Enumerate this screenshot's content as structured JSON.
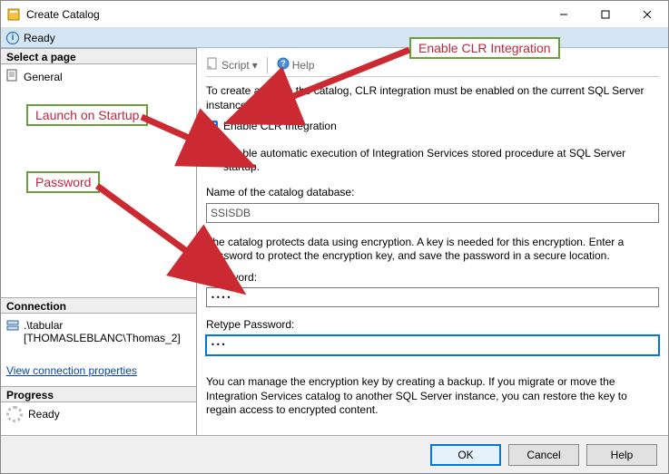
{
  "window": {
    "title": "Create Catalog"
  },
  "status": {
    "text": "Ready"
  },
  "sidebar": {
    "select_page_header": "Select a page",
    "pages": [
      {
        "label": "General"
      }
    ],
    "connection_header": "Connection",
    "conn_server": ".\\tabular",
    "conn_user": "[THOMASLEBLANC\\Thomas_2]",
    "view_props_link": "View connection properties",
    "progress_header": "Progress",
    "progress_text": "Ready"
  },
  "toolbar": {
    "script_label": "Script",
    "help_label": "Help"
  },
  "content": {
    "intro": "To create and use the catalog, CLR integration must be enabled on the current SQL Server instance.",
    "clr_check_label": "Enable CLR Integration",
    "auto_check_label": "Enable automatic execution of Integration Services stored procedure at SQL Server startup.",
    "db_name_label": "Name of the catalog database:",
    "db_name_value": "SSISDB",
    "encryption_para": "The catalog protects data using encryption. A key is needed for this encryption. Enter a password to protect the encryption key, and save the password in a secure location.",
    "password_label": "Password:",
    "password_value": "••••",
    "retype_label": "Retype Password:",
    "retype_value": "•••",
    "backup_para": "You can manage the encryption key by creating a backup. If you migrate or move the Integration Services catalog to another SQL Server instance, you can restore the key to regain access to encrypted content."
  },
  "footer": {
    "ok": "OK",
    "cancel": "Cancel",
    "help": "Help"
  },
  "annotations": {
    "clr": "Enable CLR Integration",
    "startup": "Launch on Startup",
    "password": "Password"
  }
}
